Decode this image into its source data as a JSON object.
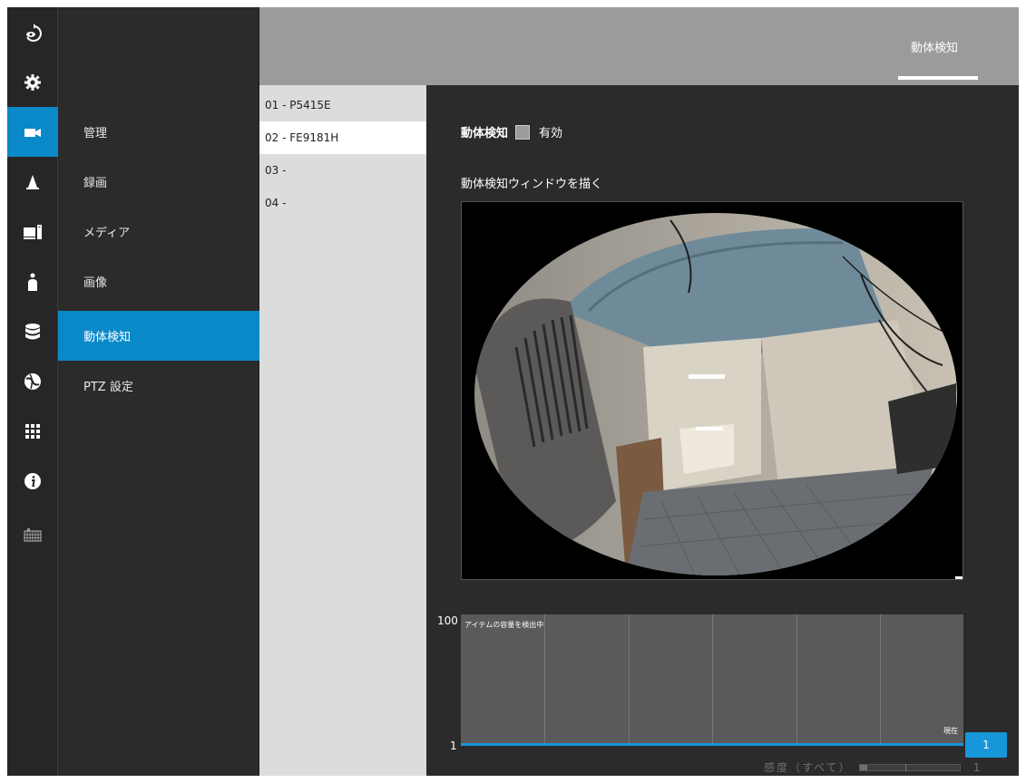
{
  "colors": {
    "accent": "#0a89c9",
    "header": "#9b9b9b",
    "panel": "#2b2b2b",
    "list": "#dcdcdc"
  },
  "rail": [
    {
      "icon": "eye-return-icon"
    },
    {
      "icon": "gear-icon"
    },
    {
      "icon": "video-camera-icon"
    },
    {
      "icon": "bell-icon"
    },
    {
      "icon": "computer-icon"
    },
    {
      "icon": "person-icon"
    },
    {
      "icon": "database-icon"
    },
    {
      "icon": "globe-icon"
    },
    {
      "icon": "apps-grid-icon"
    },
    {
      "icon": "info-icon"
    },
    {
      "icon": "keyboard-icon"
    }
  ],
  "rail_active_index": 2,
  "menu": {
    "items": [
      {
        "label": "管理"
      },
      {
        "label": "録画"
      },
      {
        "label": "メディア"
      },
      {
        "label": "画像"
      },
      {
        "label": "動体検知"
      },
      {
        "label": "PTZ 設定"
      }
    ],
    "active_index": 4
  },
  "header": {
    "tab_label": "動体検知"
  },
  "channels": {
    "items": [
      {
        "label": "01 - P5415E"
      },
      {
        "label": "02 - FE9181H"
      },
      {
        "label": "03 -"
      },
      {
        "label": "04 -"
      }
    ],
    "active_index": 1
  },
  "content": {
    "md_label": "動体検知",
    "enable_label": "有効",
    "enable_checked": false,
    "draw_window_label": "動体検知ウィンドウを描く",
    "chart_max": "100",
    "chart_min": "1",
    "chart_caption": "アイテムの容量を検出中",
    "chart_now": "現在",
    "current_value": "1",
    "sensitivity_label": "感度（すべて）",
    "sensitivity_value": "1"
  }
}
